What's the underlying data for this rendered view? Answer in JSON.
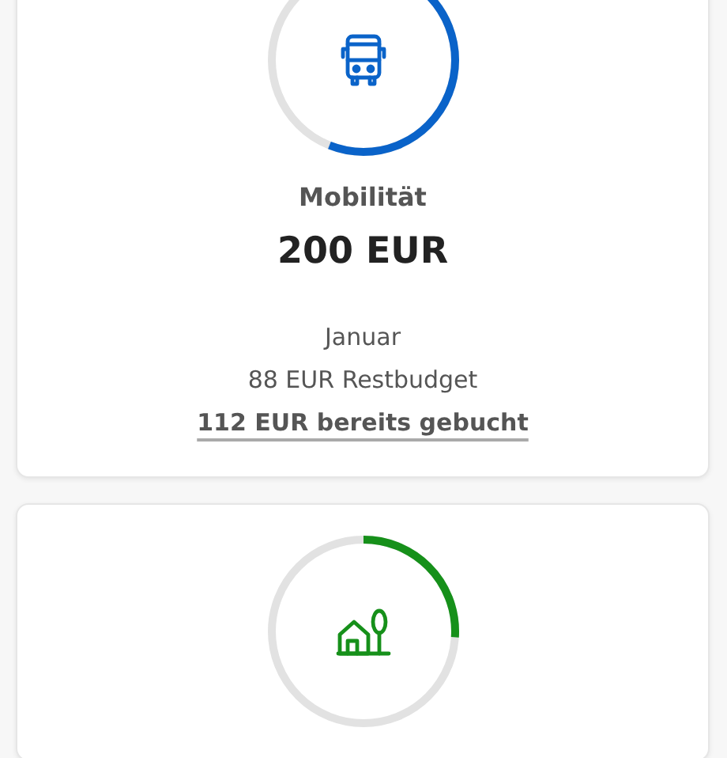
{
  "budget_cards": [
    {
      "kind": "bus",
      "color": "#0a63c9",
      "title": "Mobilität",
      "amount": "200 EUR",
      "month": "Januar",
      "remaining": "88 EUR Restbudget",
      "booked": "112 EUR bereits gebucht"
    },
    {
      "kind": "house",
      "color": "#16901a",
      "level": 0.26
    }
  ]
}
